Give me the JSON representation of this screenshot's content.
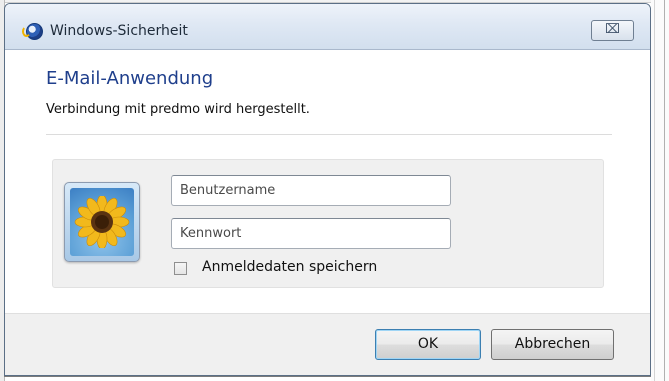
{
  "window": {
    "title": "Windows-Sicherheit",
    "close_glyph": "⌧",
    "icon": "windows-security-icon"
  },
  "dialog": {
    "heading": "E-Mail-Anwendung",
    "message": "Verbindung mit predmo wird hergestellt."
  },
  "credentials": {
    "user_icon": "user-avatar-flower",
    "username_placeholder": "Benutzername",
    "username_value": "",
    "password_placeholder": "Kennwort",
    "password_value": "",
    "remember_label": "Anmeldedaten speichern",
    "remember_checked": false
  },
  "buttons": {
    "ok": "OK",
    "cancel": "Abbrechen"
  },
  "colors": {
    "heading": "#1f3f8c",
    "titlebar": "#dfe8f4",
    "footer": "#f0f0f0",
    "default_button_border": "#3c7fb1"
  }
}
